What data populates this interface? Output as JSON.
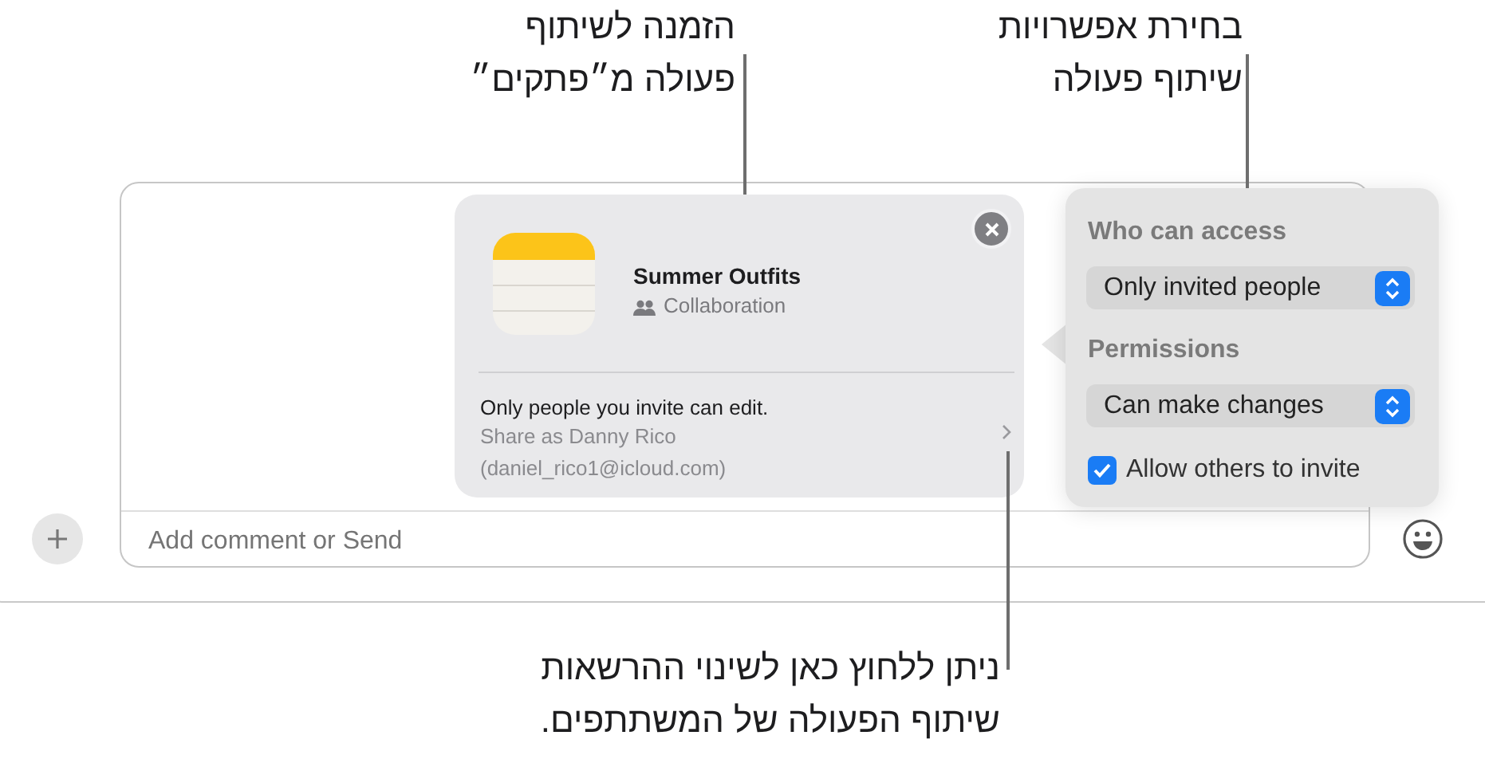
{
  "callouts": [
    {
      "text": "בחירת אפשרויות\nשיתוף פעולה"
    },
    {
      "text": "הזמנה לשיתוף\nפעולה מ״פתקים״"
    },
    {
      "text": "ניתן ללחוץ כאן לשינוי ההרשאות\nשיתוף הפעולה של המשתתפים."
    }
  ],
  "share_card": {
    "title": "Summer Outfits",
    "subtitle": "Collaboration",
    "note": "Only people you invite can edit.",
    "share_as": "Share as Danny Rico",
    "email": "(daniel_rico1@icloud.com)"
  },
  "popover": {
    "access_label": "Who can access",
    "access_value": "Only invited people",
    "permissions_label": "Permissions",
    "permissions_value": "Can make changes",
    "allow_invite": {
      "label": "Allow others to invite",
      "checked": true
    }
  },
  "composer": {
    "placeholder": "Add comment or Send"
  }
}
